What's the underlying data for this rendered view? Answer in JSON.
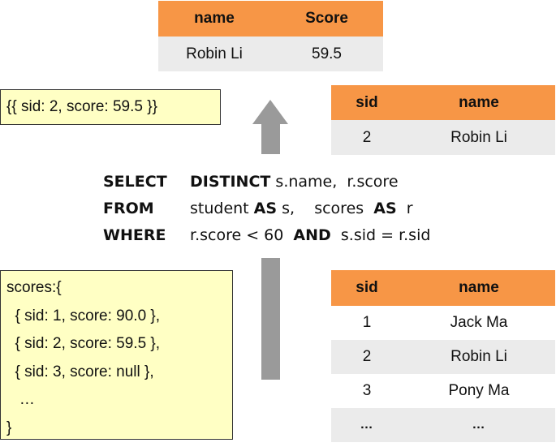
{
  "result_table": {
    "headers": [
      "name",
      "Score"
    ],
    "rows": [
      [
        "Robin Li",
        "59.5"
      ]
    ]
  },
  "matched_record": "{{ sid: 2, score: 59.5 }}",
  "filtered_table": {
    "headers": [
      "sid",
      "name"
    ],
    "rows": [
      [
        "2",
        "Robin Li"
      ]
    ]
  },
  "sql": {
    "select_kw": "SELECT",
    "distinct_kw": "DISTINCT",
    "select_cols": " s.name,  r.score",
    "from_kw": "FROM",
    "from_t1": "student ",
    "as1_kw": "AS",
    "from_a1": " s,    scores  ",
    "as2_kw": "AS",
    "from_a2": "  r",
    "where_kw": "WHERE",
    "where_c1": "r.score < 60  ",
    "and_kw": "AND",
    "where_c2": "  s.sid = r.sid"
  },
  "scores_collection": {
    "lines": [
      "scores:{",
      "  { sid: 1, score: 90.0 },",
      "  { sid: 2, score: 59.5 },",
      "  { sid: 3, score: null },",
      "   …",
      "}"
    ]
  },
  "student_table": {
    "headers": [
      "sid",
      "name"
    ],
    "rows": [
      [
        "1",
        "Jack Ma"
      ],
      [
        "2",
        "Robin Li"
      ],
      [
        "3",
        "Pony Ma"
      ],
      [
        "…",
        "…"
      ]
    ]
  },
  "colors": {
    "header_orange": "#f79646",
    "row_gray": "#ebebeb",
    "note_yellow": "#ffffc4",
    "arrow_gray": "#9a9a9a"
  }
}
